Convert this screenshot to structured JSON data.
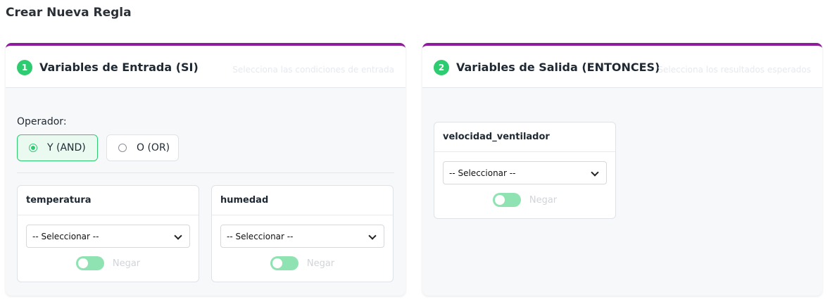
{
  "page": {
    "title": "Crear Nueva Regla"
  },
  "colors": {
    "accent": "#8e1a9c",
    "success": "#2ecc71",
    "toggle": "#8fe3b3"
  },
  "input_panel": {
    "step": "1",
    "title": "Variables de Entrada (SI)",
    "hint": "Selecciona las condiciones de entrada",
    "operator_label": "Operador:",
    "operators": [
      {
        "label": "Y (AND)",
        "selected": true
      },
      {
        "label": "O (OR)",
        "selected": false
      }
    ],
    "variables": [
      {
        "name": "temperatura",
        "select_value": "-- Seleccionar --",
        "negate_label": "Negar"
      },
      {
        "name": "humedad",
        "select_value": "-- Seleccionar --",
        "negate_label": "Negar"
      }
    ]
  },
  "output_panel": {
    "step": "2",
    "title": "Variables de Salida (ENTONCES)",
    "hint": "Selecciona los resultados esperados",
    "variables": [
      {
        "name": "velocidad_ventilador",
        "select_value": "-- Seleccionar --",
        "negate_label": "Negar"
      }
    ]
  }
}
